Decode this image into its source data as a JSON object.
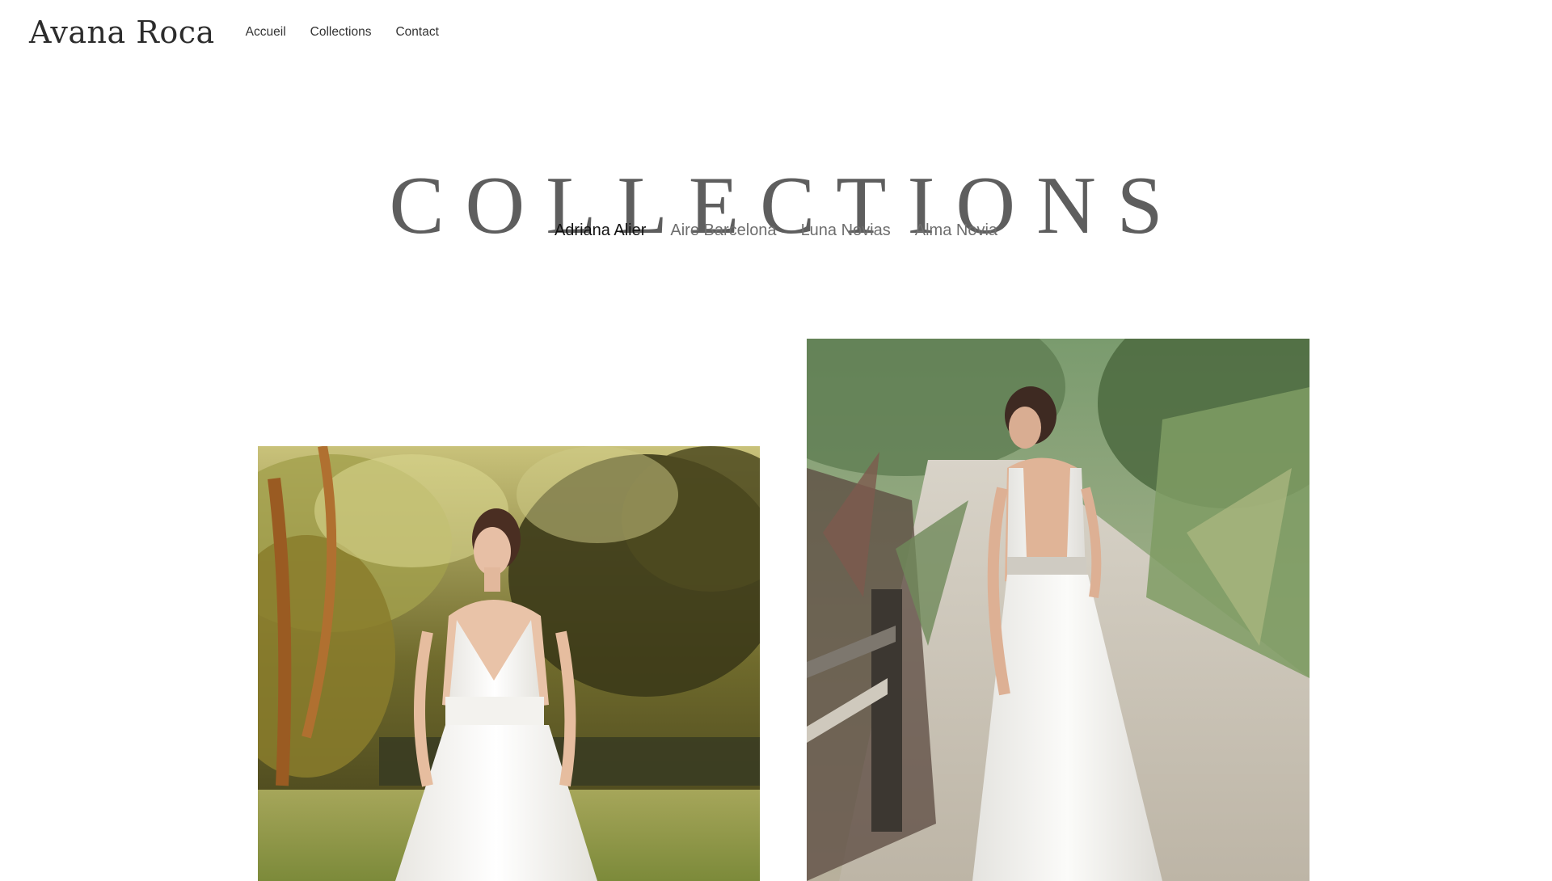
{
  "header": {
    "logo": "Avana Roca",
    "nav": [
      {
        "label": "Accueil"
      },
      {
        "label": "Collections"
      },
      {
        "label": "Contact"
      }
    ]
  },
  "main": {
    "title": "COLLECTIONS",
    "filters": [
      {
        "label": "Adriana Alier",
        "active": true
      },
      {
        "label": "Aire Barcelona",
        "active": false
      },
      {
        "label": "Luna Novias",
        "active": false
      },
      {
        "label": "Alma Novia",
        "active": false
      }
    ],
    "products": [
      {
        "image": "bride-in-garden-photo"
      },
      {
        "image": "bride-on-boardwalk-photo"
      }
    ]
  },
  "colors": {
    "background": "#ffffff",
    "title": "#5e5e5e",
    "active_filter": "#111111",
    "inactive_filter": "#6e6e6e"
  }
}
